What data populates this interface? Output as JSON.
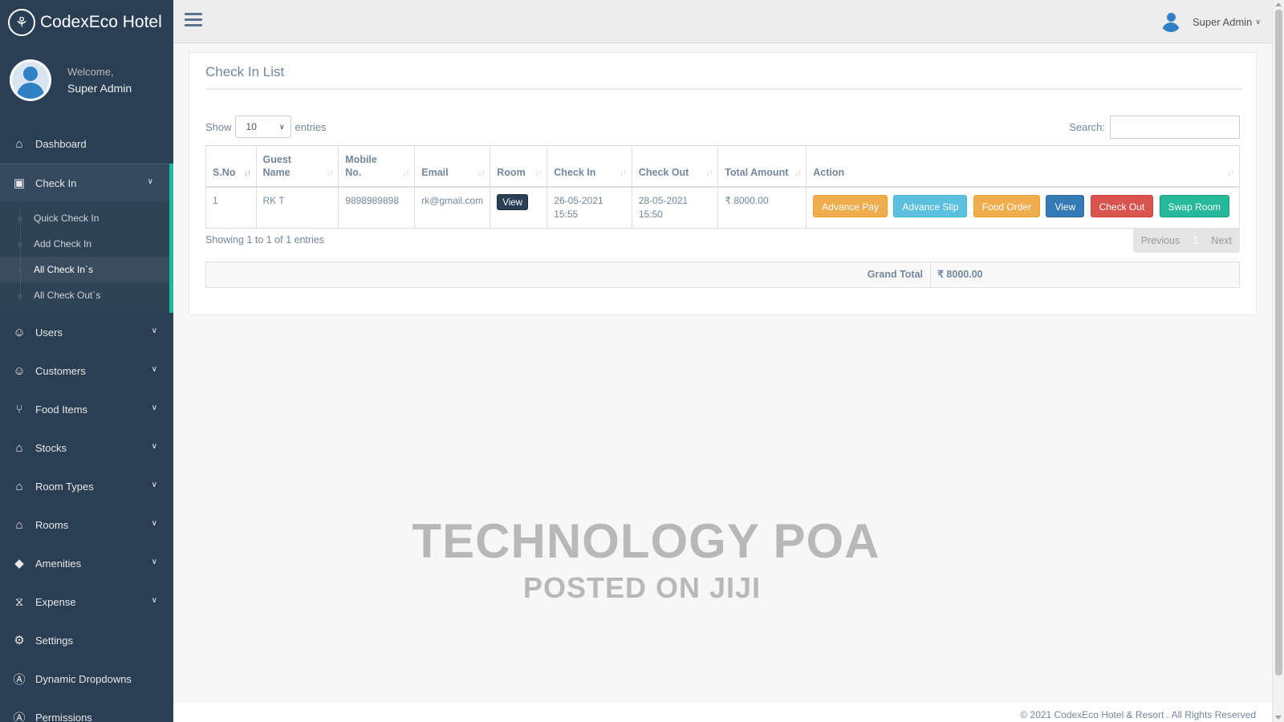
{
  "app": {
    "brand": "CodexEco Hotel"
  },
  "sidebar": {
    "welcome": "Welcome,",
    "user_name": "Super Admin",
    "items": [
      {
        "label": "Dashboard",
        "icon": "home-icon"
      },
      {
        "label": "Check In",
        "icon": "money-icon"
      },
      {
        "label": "Users",
        "icon": "user-icon"
      },
      {
        "label": "Customers",
        "icon": "user-icon"
      },
      {
        "label": "Food Items",
        "icon": "cutlery-icon"
      },
      {
        "label": "Stocks",
        "icon": "cart-icon"
      },
      {
        "label": "Room Types",
        "icon": "home-icon"
      },
      {
        "label": "Rooms",
        "icon": "home-icon"
      },
      {
        "label": "Amenities",
        "icon": "tag-icon"
      },
      {
        "label": "Expense",
        "icon": "hourglass-icon"
      },
      {
        "label": "Settings",
        "icon": "gear-icon"
      },
      {
        "label": "Dynamic Dropdowns",
        "icon": "accessibility-icon"
      },
      {
        "label": "Permissions",
        "icon": "accessibility-icon"
      }
    ],
    "check_in_sub": [
      "Quick Check In",
      "Add Check In",
      "All Check In`s",
      "All Check Out`s"
    ]
  },
  "topnav": {
    "user": "Super Admin"
  },
  "page": {
    "title": "Check In List",
    "show_label": "Show",
    "show_value": "10",
    "entries_label": "entries",
    "search_label": "Search:",
    "info": "Showing 1 to 1 of 1 entries",
    "pager": {
      "prev": "Previous",
      "page": "1",
      "next": "Next"
    },
    "grand_total_label": "Grand Total",
    "grand_total_value": "₹ 8000.00"
  },
  "table": {
    "headers": [
      "S.No",
      "Guest Name",
      "Mobile No.",
      "Email",
      "Room",
      "Check In",
      "Check Out",
      "Total Amount",
      "Action"
    ],
    "rows": [
      {
        "sno": "1",
        "guest": "RK T",
        "mobile": "9898989898",
        "email": "rk@gmail.com",
        "room_btn": "View",
        "check_in": "26-05-2021 15:55",
        "check_out": "28-05-2021 15:50",
        "total": "₹ 8000.00",
        "actions": [
          "Advance Pay",
          "Advance Slip",
          "Food Order",
          "View",
          "Check Out",
          "Swap Room"
        ]
      }
    ]
  },
  "watermark": {
    "line1": "TECHNOLOGY POA",
    "line2": "POSTED ON JIJI"
  },
  "footer": {
    "text": "© 2021 CodexEco Hotel & Resort . All Rights Reserved"
  },
  "colors": {
    "sidebar": "#2a3f54",
    "accent": "#1abb9c",
    "warning": "#f0ad4e",
    "info": "#5bc0de",
    "primary": "#337ab7",
    "danger": "#d9534f",
    "success": "#26b99a"
  }
}
